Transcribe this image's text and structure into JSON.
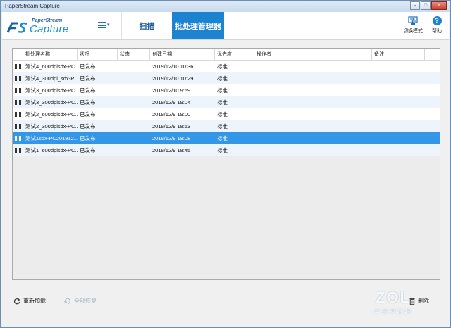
{
  "window": {
    "title": "PaperStream Capture",
    "buttons": [
      "–",
      "□",
      "×"
    ]
  },
  "header": {
    "logo_top": "PaperStream",
    "logo_main": "Capture",
    "tabs": [
      {
        "label": "扫描",
        "active": false
      },
      {
        "label": "批处理管理器",
        "active": true
      }
    ],
    "switch_mode_label": "切换模式",
    "help_label": "帮助"
  },
  "grid": {
    "columns": [
      "批处理名称",
      "状况",
      "状态",
      "创建日期",
      "优先度",
      "操作者",
      "备注"
    ],
    "rows": [
      {
        "name": "测试4_600dpisdx-PC...",
        "condition": "已发布",
        "status": "",
        "created": "2019/12/10 10:36",
        "priority": "标准",
        "operator": "",
        "note": "",
        "selected": false
      },
      {
        "name": "测试4_300dpi_sdx-P...",
        "condition": "已发布",
        "status": "",
        "created": "2019/12/10 10:29",
        "priority": "标准",
        "operator": "",
        "note": "",
        "selected": false
      },
      {
        "name": "测试3_600dpisdx-PC...",
        "condition": "已发布",
        "status": "",
        "created": "2019/12/10  9:59",
        "priority": "标准",
        "operator": "",
        "note": "",
        "selected": false
      },
      {
        "name": "测试3_300dpisdx-PC...",
        "condition": "已发布",
        "status": "",
        "created": "2019/12/9 19:04",
        "priority": "标准",
        "operator": "",
        "note": "",
        "selected": false
      },
      {
        "name": "测试2_600dpisdx-PC...",
        "condition": "已发布",
        "status": "",
        "created": "2019/12/9 19:00",
        "priority": "标准",
        "operator": "",
        "note": "",
        "selected": false
      },
      {
        "name": "测试2_300dpisdx-PC...",
        "condition": "已发布",
        "status": "",
        "created": "2019/12/9 18:53",
        "priority": "标准",
        "operator": "",
        "note": "",
        "selected": false
      },
      {
        "name": "测试1sdx-PC201912...",
        "condition": "已发布",
        "status": "",
        "created": "2019/12/9 18:08",
        "priority": "标准",
        "operator": "",
        "note": "",
        "selected": true
      },
      {
        "name": "测试1_600dpisdx-PC...",
        "condition": "已发布",
        "status": "",
        "created": "2019/12/9 18:45",
        "priority": "标准",
        "operator": "",
        "note": "",
        "selected": false
      }
    ]
  },
  "footer": {
    "reload_label": "重新加载",
    "restore_all_label": "全部恢复",
    "delete_label": "删除"
  },
  "watermark": {
    "big": "ZOL",
    "small": "中关村在线"
  },
  "colors": {
    "accent": "#1b83d0",
    "selected_row": "#3396e6"
  }
}
